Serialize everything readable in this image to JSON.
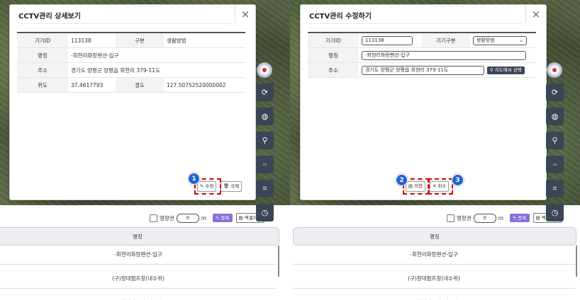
{
  "left": {
    "title": "CCTV관리 상세보기",
    "close": "×",
    "rows": [
      {
        "label": "기기ID",
        "value": "113138",
        "label2": "구분",
        "value2": "생활방범"
      },
      {
        "label": "명칭",
        "value": "-회현리화랑펜션-입구"
      },
      {
        "label": "주소",
        "value": "경기도 양평군 양평읍 회현리 379-11도"
      },
      {
        "label": "위도",
        "value": "37.4617793",
        "label2": "경도",
        "value2": "127.50752520000002"
      }
    ],
    "edit_button": "수정",
    "delete_button": "삭제",
    "callout": "1"
  },
  "right": {
    "title": "CCTV관리 수정하기",
    "close": "×",
    "device_id_label": "기기ID",
    "device_id_value": "113138",
    "type_label": "기기구분",
    "type_value": "생활방범",
    "name_label": "명칭",
    "name_value": "-회현리화랑펜션-입구",
    "address_label": "주소",
    "address_value": "경기도 양평군 양평읍 회현리 379-11도",
    "map_select_button": "지도에서 선택",
    "save_button": "저장",
    "cancel_button": "취소",
    "callout_save": "2",
    "callout_cancel": "3"
  },
  "lower": {
    "radius_label": "영향권",
    "radius_value": "0",
    "radius_unit": "m",
    "register_button": "등록",
    "excel_button": "엑셀저장",
    "column_header": "명칭",
    "rows": [
      "-회현리화랑펜션-입구",
      "(구)창대펌프장(내수위)",
      "(구)창대펌프장(외수위)"
    ]
  },
  "colors": {
    "accent_dark": "#3b4556",
    "register_purple": "#8a6fd9",
    "callout_blue": "#1f66d1",
    "highlight_red": "#d60000"
  }
}
